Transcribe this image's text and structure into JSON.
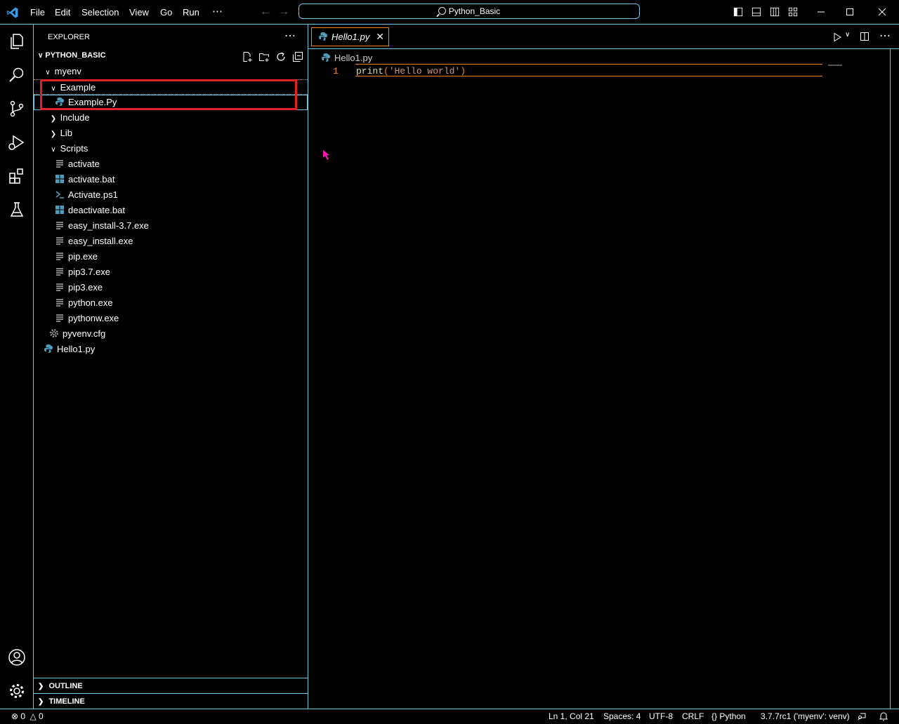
{
  "titlebar": {
    "menus": [
      "File",
      "Edit",
      "Selection",
      "View",
      "Go",
      "Run",
      "⋯"
    ],
    "command_center": "Python_Basic"
  },
  "explorer": {
    "header": "EXPLORER",
    "more": "⋯",
    "folder_title": "PYTHON_BASIC",
    "tree": [
      {
        "label": "myenv",
        "type": "folder-open",
        "depth": 1
      },
      {
        "label": "Example",
        "type": "folder-open",
        "depth": 2
      },
      {
        "label": "Example.Py",
        "type": "python",
        "depth": 3
      },
      {
        "label": "Include",
        "type": "folder-closed",
        "depth": 2
      },
      {
        "label": "Lib",
        "type": "folder-closed",
        "depth": 2
      },
      {
        "label": "Scripts",
        "type": "folder-open",
        "depth": 2
      },
      {
        "label": "activate",
        "type": "text",
        "depth": 3
      },
      {
        "label": "activate.bat",
        "type": "windows",
        "depth": 3
      },
      {
        "label": "Activate.ps1",
        "type": "powershell",
        "depth": 3
      },
      {
        "label": "deactivate.bat",
        "type": "windows",
        "depth": 3
      },
      {
        "label": "easy_install-3.7.exe",
        "type": "text",
        "depth": 3
      },
      {
        "label": "easy_install.exe",
        "type": "text",
        "depth": 3
      },
      {
        "label": "pip.exe",
        "type": "text",
        "depth": 3
      },
      {
        "label": "pip3.7.exe",
        "type": "text",
        "depth": 3
      },
      {
        "label": "pip3.exe",
        "type": "text",
        "depth": 3
      },
      {
        "label": "python.exe",
        "type": "text",
        "depth": 3
      },
      {
        "label": "pythonw.exe",
        "type": "text",
        "depth": 3
      },
      {
        "label": "pyvenv.cfg",
        "type": "gear",
        "depth": 2
      },
      {
        "label": "Hello1.py",
        "type": "python",
        "depth": 1
      }
    ],
    "outline": "OUTLINE",
    "timeline": "TIMELINE"
  },
  "editor": {
    "tab_label": "Hello1.py",
    "breadcrumb": "Hello1.py",
    "line_number": "1",
    "code_func": "print",
    "code_open": "(",
    "code_string": "'Hello world'",
    "code_close": ")"
  },
  "statusbar": {
    "errors": "0",
    "warnings": "0",
    "position": "Ln 1, Col 21",
    "spaces": "Spaces: 4",
    "encoding": "UTF-8",
    "eol": "CRLF",
    "language": "Python",
    "interpreter": "3.7.7rc1 ('myenv': venv)"
  },
  "colors": {
    "contrast_border": "#6fc3df",
    "active_border": "#f38518",
    "highlight_box": "#e02020",
    "python_icon": "#519aba",
    "string": "#ce9178",
    "function": "#dcdcaa"
  }
}
